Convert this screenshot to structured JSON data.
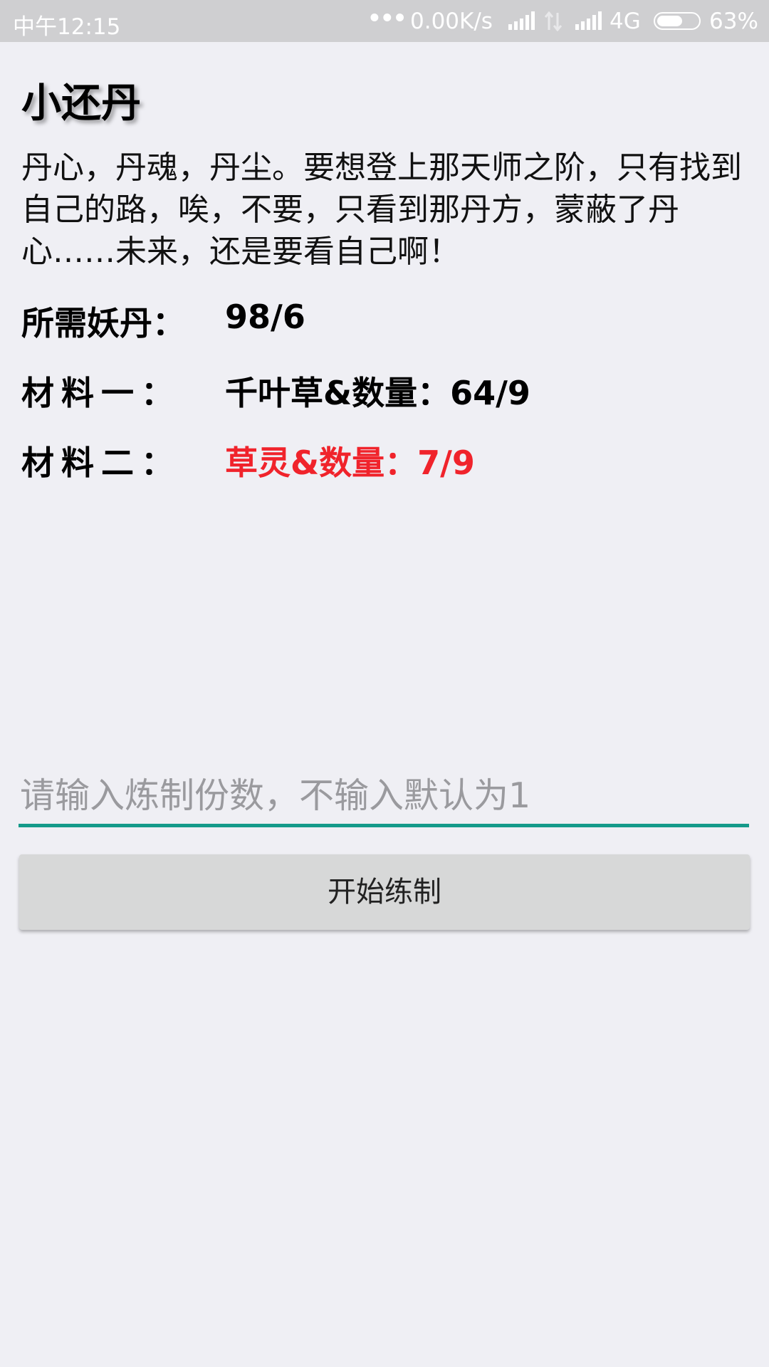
{
  "status_bar": {
    "time": "中午12:15",
    "dots": "•••",
    "net_speed": "0.00K/s",
    "network_type": "4G",
    "battery_percent": "63%",
    "battery_level": 0.63,
    "icons": [
      "signal-icon",
      "data-transfer-icon",
      "signal-icon",
      "battery-icon"
    ]
  },
  "content": {
    "title": "小还丹",
    "description": "丹心，丹魂，丹尘。要想登上那天师之阶，只有找到自己的路，唉，不要，只看到那丹方，蒙蔽了丹心……未来，还是要看自己啊！",
    "rows": [
      {
        "label": "所需妖丹：",
        "value": "98/6",
        "color": "#000000"
      },
      {
        "label": "材料一：",
        "value": "千叶草&数量：64/9",
        "color": "#000000"
      },
      {
        "label": "材料二：",
        "value": "草灵&数量：7/9",
        "color": "#f0232b"
      }
    ]
  },
  "form": {
    "quantity_placeholder": "请输入炼制份数，不输入默认为1",
    "quantity_value": "",
    "accent_color": "#159a8a",
    "start_button_label": "开始练制"
  }
}
